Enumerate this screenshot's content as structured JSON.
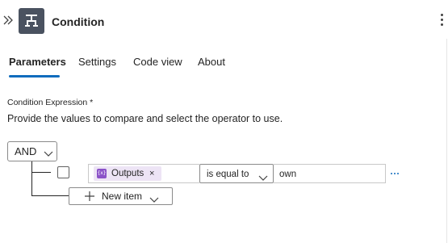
{
  "header": {
    "title": "Condition",
    "collapse_icon": "double-chevron-right-icon",
    "action_icon": "condition-icon",
    "more_icon": "more-vertical-icon"
  },
  "tabs": [
    {
      "label": "Parameters",
      "active": true
    },
    {
      "label": "Settings",
      "active": false
    },
    {
      "label": "Code view",
      "active": false
    },
    {
      "label": "About",
      "active": false
    }
  ],
  "section": {
    "label": "Condition Expression *",
    "description": "Provide the values to compare and select the operator to use."
  },
  "group": {
    "operator": "AND",
    "rows": [
      {
        "left_token": {
          "label": "Outputs",
          "remove": "×",
          "icon": "expression-token-icon",
          "icon_text": "{x}"
        },
        "operator": "is equal to",
        "right_value": "own",
        "checked": false
      }
    ],
    "new_item_label": "New item"
  },
  "colors": {
    "accent": "#0f6cbd",
    "header_icon_bg": "#4a5260",
    "token_bg": "#ede4f5",
    "token_icon_bg": "#8b52c8"
  }
}
